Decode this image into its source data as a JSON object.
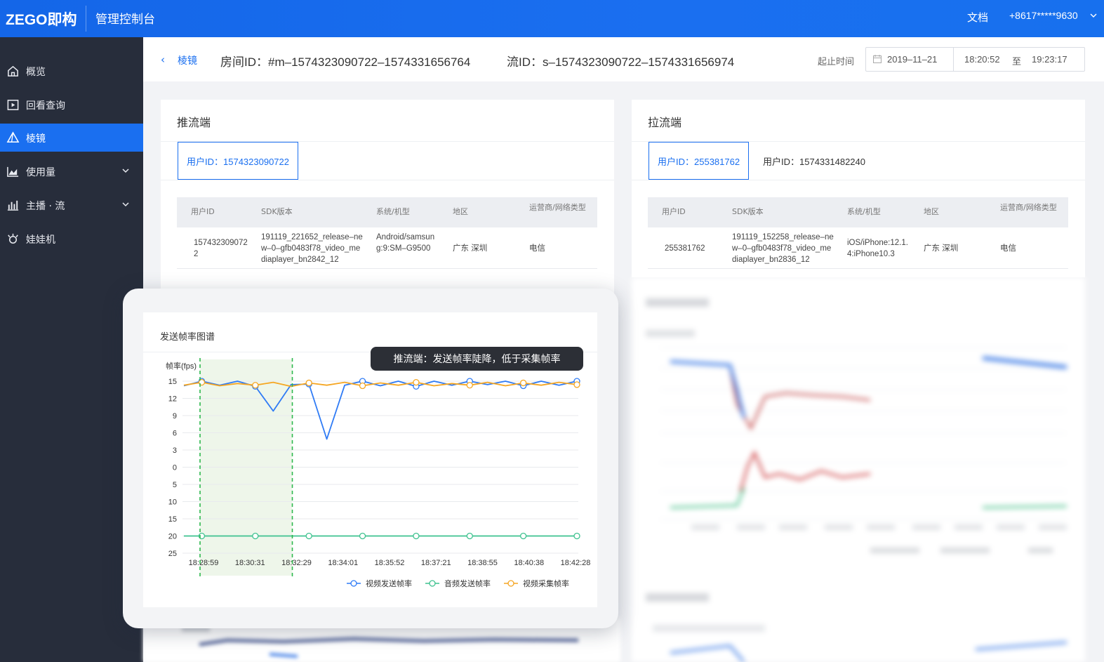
{
  "topbar": {
    "logo": "ZEGO即构",
    "console_title": "管理控制台",
    "docs": "文档",
    "account": "+8617*****9630"
  },
  "sidebar": {
    "items": [
      {
        "label": "概览",
        "icon": "home-icon"
      },
      {
        "label": "回看查询",
        "icon": "playback-icon"
      },
      {
        "label": "棱镜",
        "icon": "prism-icon",
        "active": true
      },
      {
        "label": "使用量",
        "icon": "area-chart-icon",
        "expandable": true
      },
      {
        "label": "主播 · 流",
        "icon": "bar-chart-icon",
        "expandable": true
      },
      {
        "label": "娃娃机",
        "icon": "claw-machine-icon"
      }
    ]
  },
  "header": {
    "back_label": "棱镜",
    "room_id": "房间ID：#m–1574323090722–1574331656764",
    "stream_id": "流ID：s–1574323090722–1574331656974",
    "time_label": "起止时间",
    "date": "2019–11–21",
    "start_time": "18:20:52",
    "to": "至",
    "end_time": "19:23:17"
  },
  "push_panel": {
    "title": "推流端",
    "user_tabs": [
      "用户ID：1574323090722"
    ],
    "columns": [
      "用户ID",
      "SDK版本",
      "系统/机型",
      "地区",
      "运营商/网络类型"
    ],
    "row": {
      "user_id": "1574323090722",
      "sdk": "191119_221652_release–new–0–gfb0483f78_video_mediaplayer_bn2842_12",
      "system": "Android/samsung:9:SM–G9500",
      "region": "广东 深圳",
      "carrier": "电信"
    }
  },
  "pull_panel": {
    "title": "拉流端",
    "user_tabs": [
      "用户ID：255381762",
      "用户ID：1574331482240"
    ],
    "columns": [
      "用户ID",
      "SDK版本",
      "系统/机型",
      "地区",
      "运营商/网络类型"
    ],
    "row": {
      "user_id": "255381762",
      "sdk": "191119_152258_release–new–0–gfb0483f78_video_mediaplayer_bn2836_12",
      "system": "iOS/iPhone:12.1.4:iPhone10.3",
      "region": "广东 深圳",
      "carrier": "电信"
    }
  },
  "popup": {
    "chart_title": "发送帧率图谱",
    "tooltip": "推流端：发送帧率陡降，低于采集帧率"
  },
  "colors": {
    "brand": "#1a6ff0",
    "sidebar_bg": "#272d3b",
    "video_send": "#2f7bf5",
    "audio_send": "#3ec28f",
    "video_capture": "#f5a623",
    "highlight_band": "#eef6ea",
    "marker_line": "#2db84d"
  },
  "chart_data": {
    "type": "line",
    "title": "发送帧率图谱",
    "ylabel": "帧率(fps)",
    "y_ticks": [
      "15",
      "12",
      "9",
      "6",
      "3",
      "0",
      "5",
      "10",
      "15",
      "20",
      "25"
    ],
    "x_ticks": [
      "18:28:59",
      "18:30:31",
      "18:32:29",
      "18:34:01",
      "18:35:52",
      "18:37:21",
      "18:38:55",
      "18:40:38",
      "18:42:28"
    ],
    "highlight_range": [
      "18:28:59",
      "18:32:29"
    ],
    "series": [
      {
        "name": "视频发送帧率",
        "color": "#2f7bf5",
        "values": [
          14.2,
          15,
          14.3,
          15,
          14.1,
          9.8,
          14.4,
          14.5,
          4.9,
          14.3,
          15,
          14.2,
          15,
          14.1,
          15,
          14.3,
          15,
          14.4,
          15,
          14.2,
          15,
          14.3,
          15
        ]
      },
      {
        "name": "音频发送帧率",
        "color": "#3ec28f",
        "values": [
          20,
          20,
          20,
          20,
          20,
          20,
          20,
          20,
          20,
          20,
          20,
          20,
          20,
          20,
          20,
          20,
          20,
          20,
          20,
          20,
          20,
          20,
          20
        ]
      },
      {
        "name": "视频采集帧率",
        "color": "#f5a623",
        "values": [
          14.3,
          14.8,
          14.2,
          14.6,
          14.3,
          14.8,
          14.1,
          14.7,
          14.3,
          14.8,
          14.2,
          14.7,
          14.3,
          14.8,
          14.2,
          14.6,
          14.3,
          14.8,
          14.2,
          14.7,
          14.3,
          14.8,
          14.4
        ]
      }
    ],
    "legend": [
      "视频发送帧率",
      "音频发送帧率",
      "视频采集帧率"
    ],
    "legend_position": "bottom-right",
    "grid": true
  }
}
